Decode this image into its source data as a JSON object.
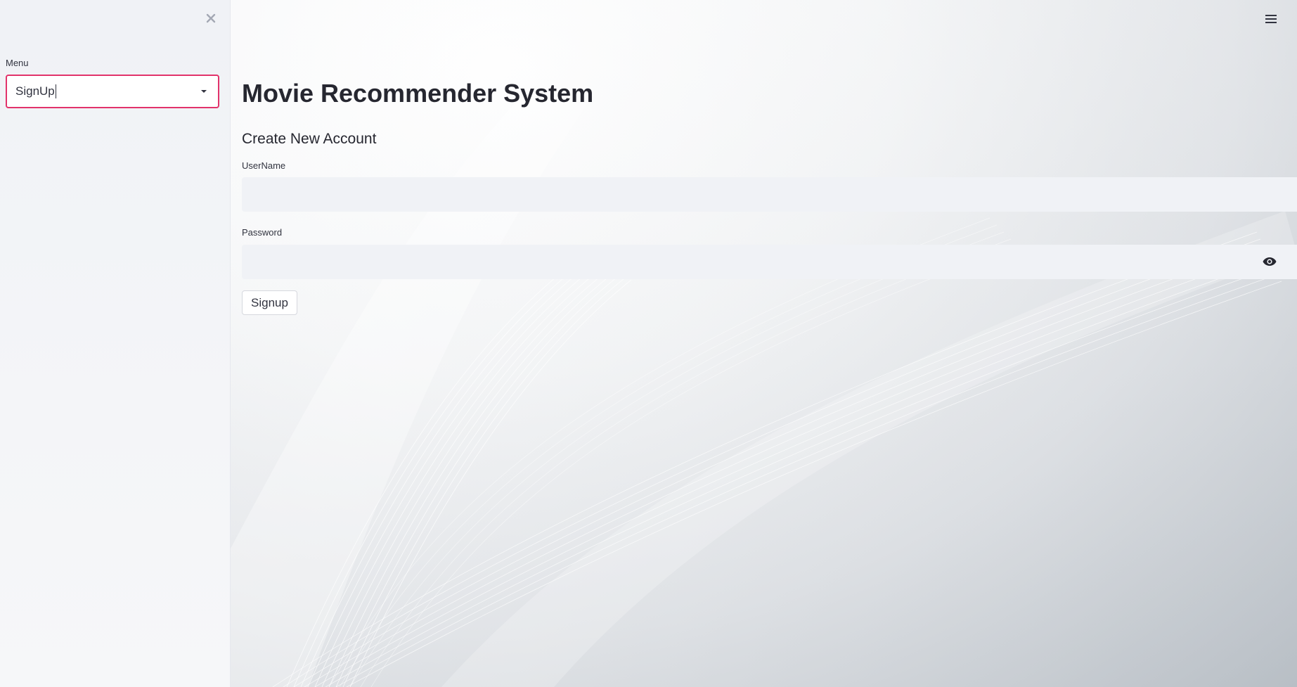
{
  "sidebar": {
    "close_icon": "close-icon",
    "menu_label": "Menu",
    "selected_option": "SignUp",
    "accent_color": "#e2336b"
  },
  "header": {
    "menu_icon": "hamburger-icon"
  },
  "main": {
    "title": "Movie Recommender System",
    "subheader": "Create New Account",
    "username_label": "UserName",
    "username_value": "",
    "password_label": "Password",
    "password_value": "",
    "password_toggle_icon": "eye-icon",
    "signup_button": "Signup"
  }
}
